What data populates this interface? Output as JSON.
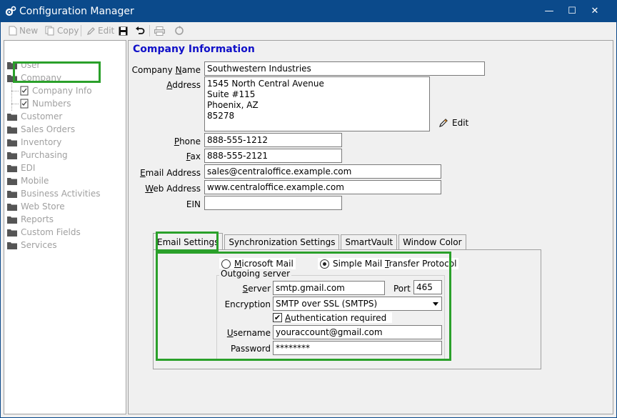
{
  "window": {
    "title": "Configuration Manager",
    "icon": "gear-icon"
  },
  "toolbar": {
    "new_label": "New",
    "copy_label": "Copy",
    "edit_label": "Edit"
  },
  "tree": {
    "items": [
      {
        "label": "User",
        "icon": "folder-icon"
      },
      {
        "label": "Company",
        "icon": "folder-open-icon"
      },
      {
        "label": "Company Info",
        "icon": "document-icon"
      },
      {
        "label": "Numbers",
        "icon": "document-icon"
      },
      {
        "label": "Customer",
        "icon": "folder-icon"
      },
      {
        "label": "Sales Orders",
        "icon": "folder-icon"
      },
      {
        "label": "Inventory",
        "icon": "folder-icon"
      },
      {
        "label": "Purchasing",
        "icon": "folder-icon"
      },
      {
        "label": "EDI",
        "icon": "folder-icon"
      },
      {
        "label": "Mobile",
        "icon": "folder-icon"
      },
      {
        "label": "Business Activities",
        "icon": "folder-icon"
      },
      {
        "label": "Web Store",
        "icon": "folder-icon"
      },
      {
        "label": "Reports",
        "icon": "folder-icon"
      },
      {
        "label": "Custom Fields",
        "icon": "folder-icon"
      },
      {
        "label": "Services",
        "icon": "folder-icon"
      }
    ]
  },
  "company": {
    "heading": "Company Information",
    "name_label_pre": "Company ",
    "name_label_u": "N",
    "name_label_post": "ame",
    "name_value": "Southwestern Industries",
    "address_label_u": "A",
    "address_label_post": "ddress",
    "address_lines": [
      "1545 North Central Avenue",
      "Suite #115",
      "Phoenix, AZ",
      "85278"
    ],
    "edit_label": "Edit",
    "phone_label_pre": "",
    "phone_label_u": "P",
    "phone_label_post": "hone",
    "phone_value": "888-555-1212",
    "fax_label_u": "F",
    "fax_label_post": "ax",
    "fax_value": "888-555-2121",
    "email_label_u": "E",
    "email_label_post": "mail Address",
    "email_value": "sales@centraloffice.example.com",
    "web_label_u": "W",
    "web_label_post": "eb Address",
    "web_value": "www.centraloffice.example.com",
    "ein_label": "EIN",
    "ein_value": ""
  },
  "tabs": [
    "Email Settings",
    "Synchronization Settings",
    "SmartVault",
    "Window Color"
  ],
  "email": {
    "radio_ms_pre": "",
    "radio_ms_u": "M",
    "radio_ms_post": "icrosoft Mail",
    "radio_smtp_pre": "Simple Mail ",
    "radio_smtp_u": "T",
    "radio_smtp_post": "ransfer Protocol",
    "selected": "smtp",
    "group_title": "Outgoing server",
    "server_label_pre": "",
    "server_label_u": "S",
    "server_label_post": "erver",
    "server_value": "smtp.gmail.com",
    "port_label": "Port",
    "port_value": "465",
    "encryption_label": "Encryption",
    "encryption_value": "SMTP over SSL (SMTPS)",
    "auth_label_u": "A",
    "auth_label_post": "uthentication required",
    "auth_checked": true,
    "username_label_u": "U",
    "username_label_post": "sername",
    "username_value": "youraccount@gmail.com",
    "password_label": "Password",
    "password_value": "********"
  }
}
